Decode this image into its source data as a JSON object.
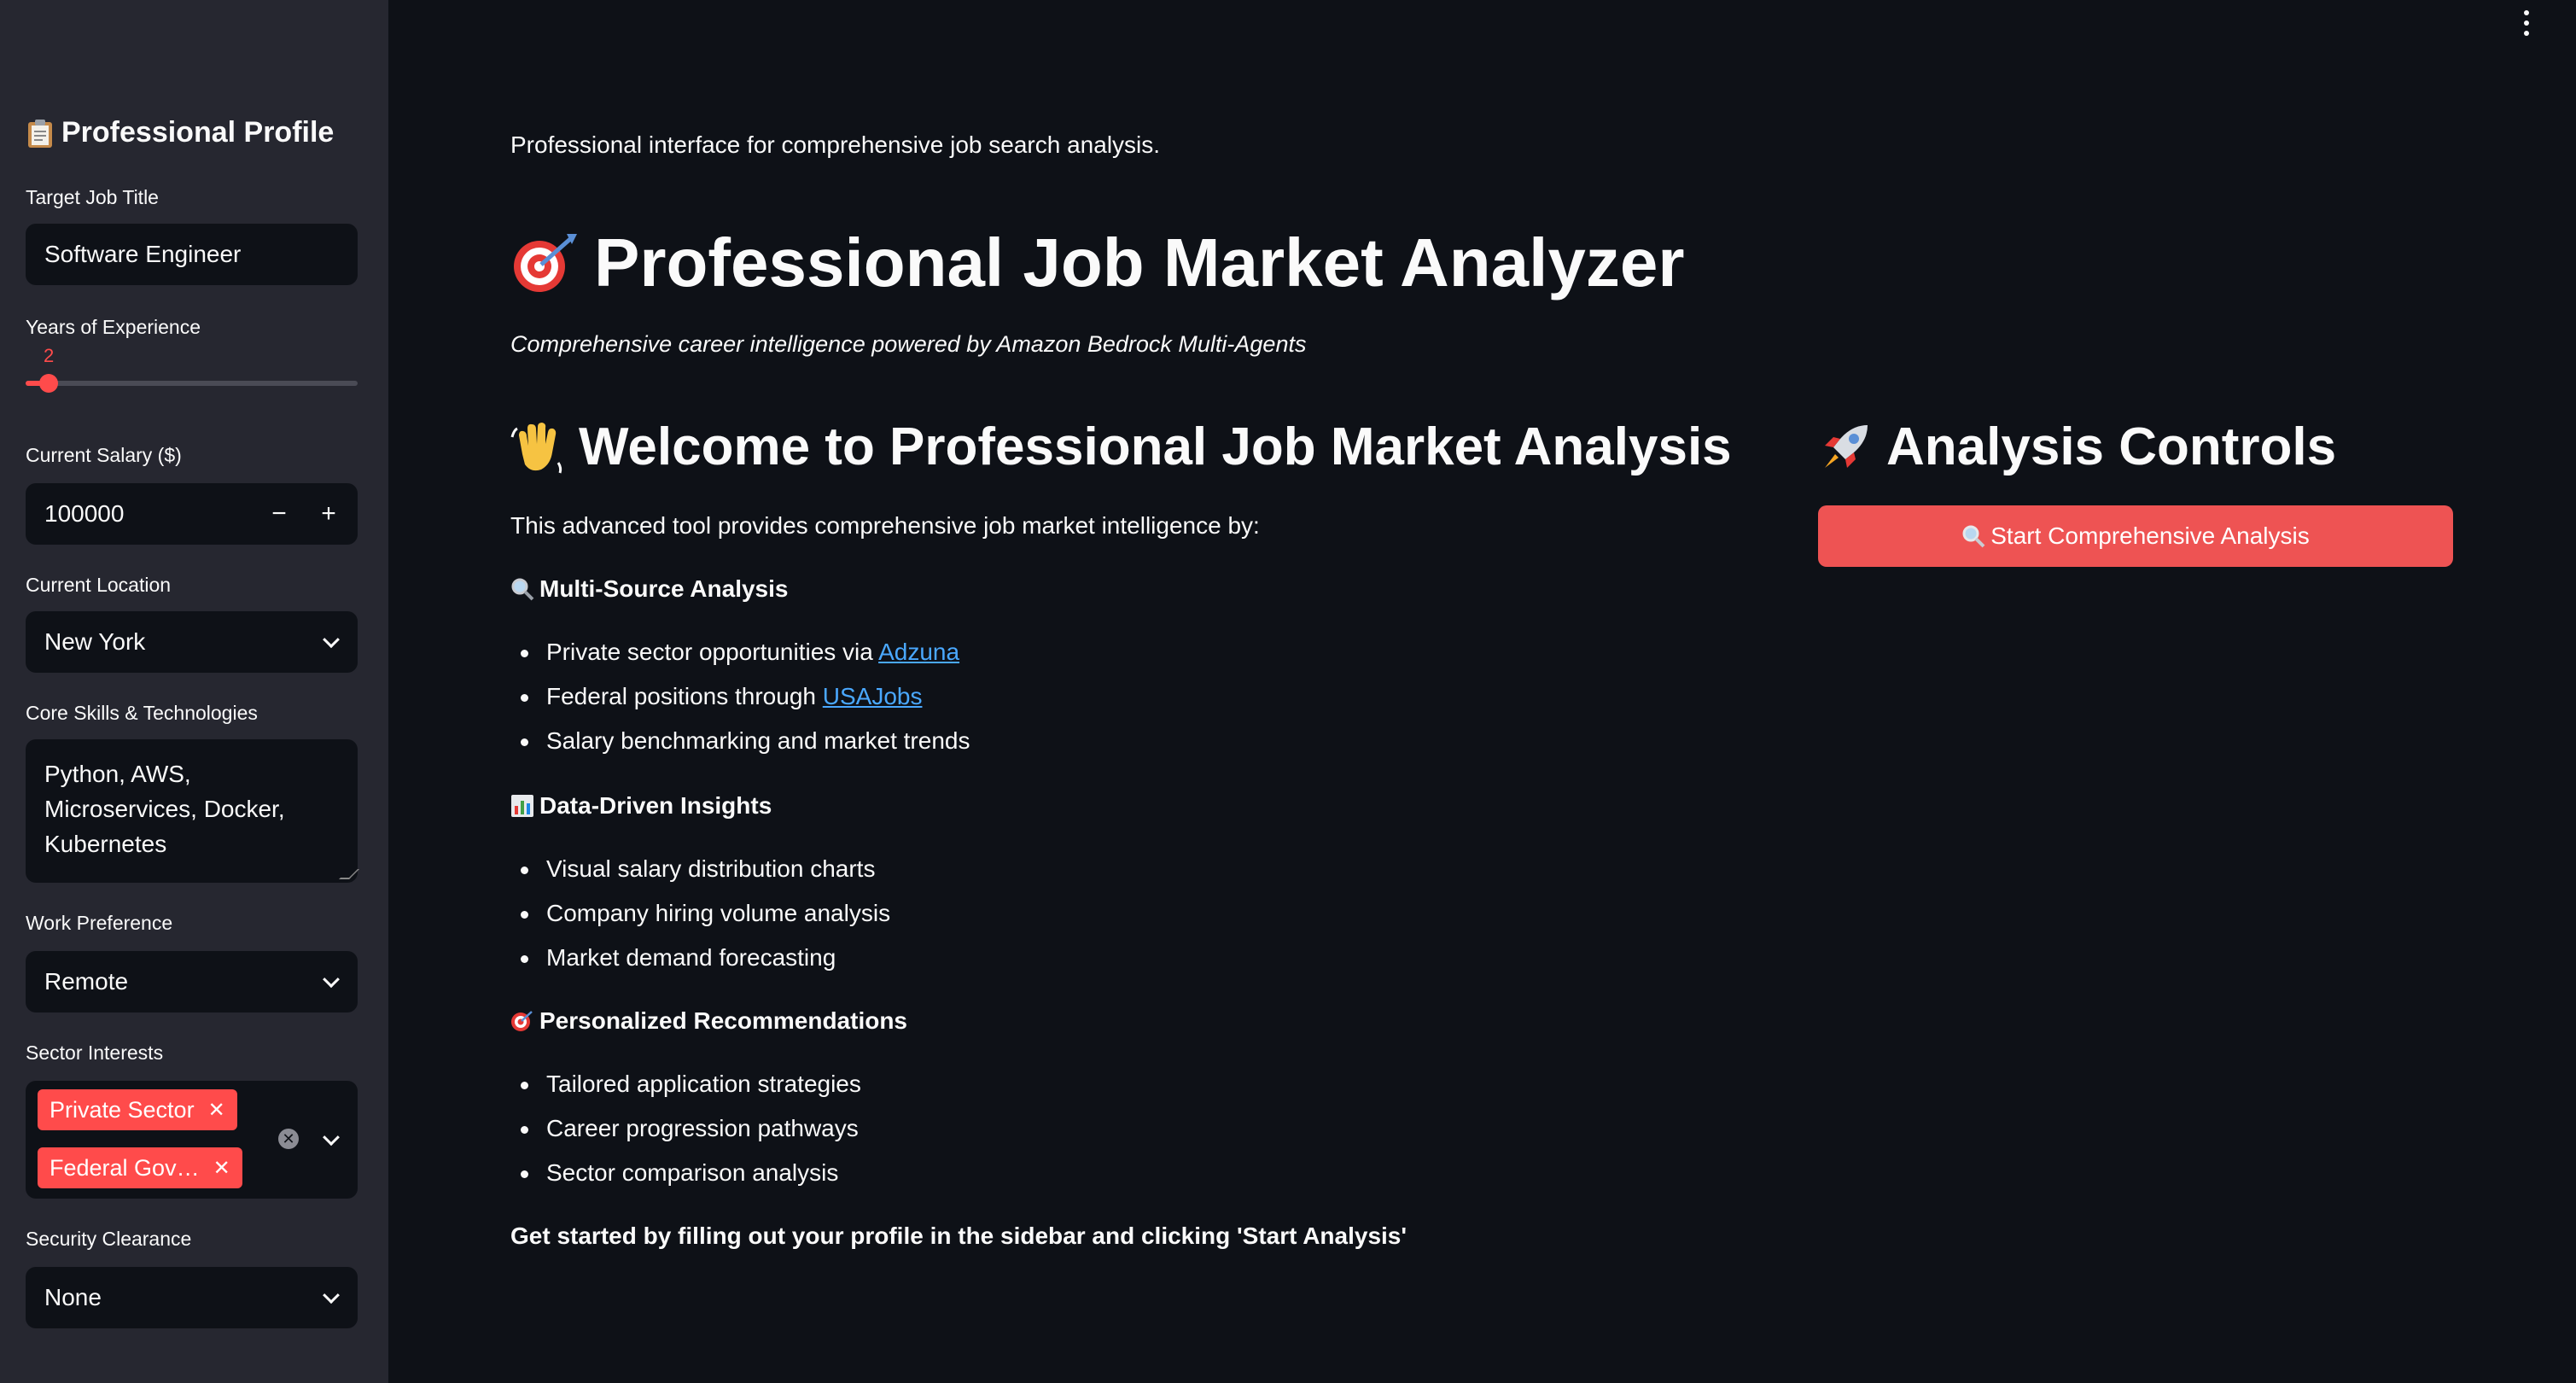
{
  "sidebar": {
    "title": "Professional Profile",
    "title_icon": "clipboard-icon",
    "job_title": {
      "label": "Target Job Title",
      "value": "Software Engineer"
    },
    "experience": {
      "label": "Years of Experience",
      "value": "2",
      "fraction": 0.05
    },
    "salary": {
      "label": "Current Salary ($)",
      "value": "100000",
      "minus": "−",
      "plus": "+"
    },
    "location": {
      "label": "Current Location",
      "value": "New York"
    },
    "skills": {
      "label": "Core Skills & Technologies",
      "value": "Python, AWS, Microservices, Docker, Kubernetes"
    },
    "work_pref": {
      "label": "Work Preference",
      "value": "Remote"
    },
    "sectors": {
      "label": "Sector Interests",
      "tags": [
        "Private Sector",
        "Federal Gov…"
      ]
    },
    "clearance": {
      "label": "Security Clearance",
      "value": "None"
    }
  },
  "main": {
    "intro": "Professional interface for comprehensive job search analysis.",
    "title": "Professional Job Market Analyzer",
    "title_icon": "target-icon",
    "subtitle": "Comprehensive career intelligence powered by Amazon Bedrock Multi-Agents",
    "welcome_title": "Welcome to Professional Job Market Analysis",
    "welcome_icon": "waving-hand-icon",
    "welcome_intro": "This advanced tool provides comprehensive job market intelligence by:",
    "sections": [
      {
        "icon": "magnifier-icon",
        "heading": "Multi-Source Analysis",
        "items": [
          {
            "pre": "Private sector opportunities via ",
            "link": "Adzuna"
          },
          {
            "pre": "Federal positions through ",
            "link": "USAJobs"
          },
          {
            "pre": "Salary benchmarking and market trends"
          }
        ]
      },
      {
        "icon": "bar-chart-icon",
        "heading": "Data-Driven Insights",
        "items": [
          {
            "pre": "Visual salary distribution charts"
          },
          {
            "pre": "Company hiring volume analysis"
          },
          {
            "pre": "Market demand forecasting"
          }
        ]
      },
      {
        "icon": "target-icon",
        "heading": "Personalized Recommendations",
        "items": [
          {
            "pre": "Tailored application strategies"
          },
          {
            "pre": "Career progression pathways"
          },
          {
            "pre": "Sector comparison analysis"
          }
        ]
      }
    ],
    "cta": "Get started by filling out your profile in the sidebar and clicking 'Start Analysis'",
    "controls_title": "Analysis Controls",
    "controls_icon": "rocket-icon",
    "start_button": "Start Comprehensive Analysis"
  },
  "colors": {
    "accent": "#ff4b4b",
    "button": "#ee5353",
    "link": "#4aa8ff",
    "bg": "#0e1117",
    "sidebar": "#262730"
  }
}
